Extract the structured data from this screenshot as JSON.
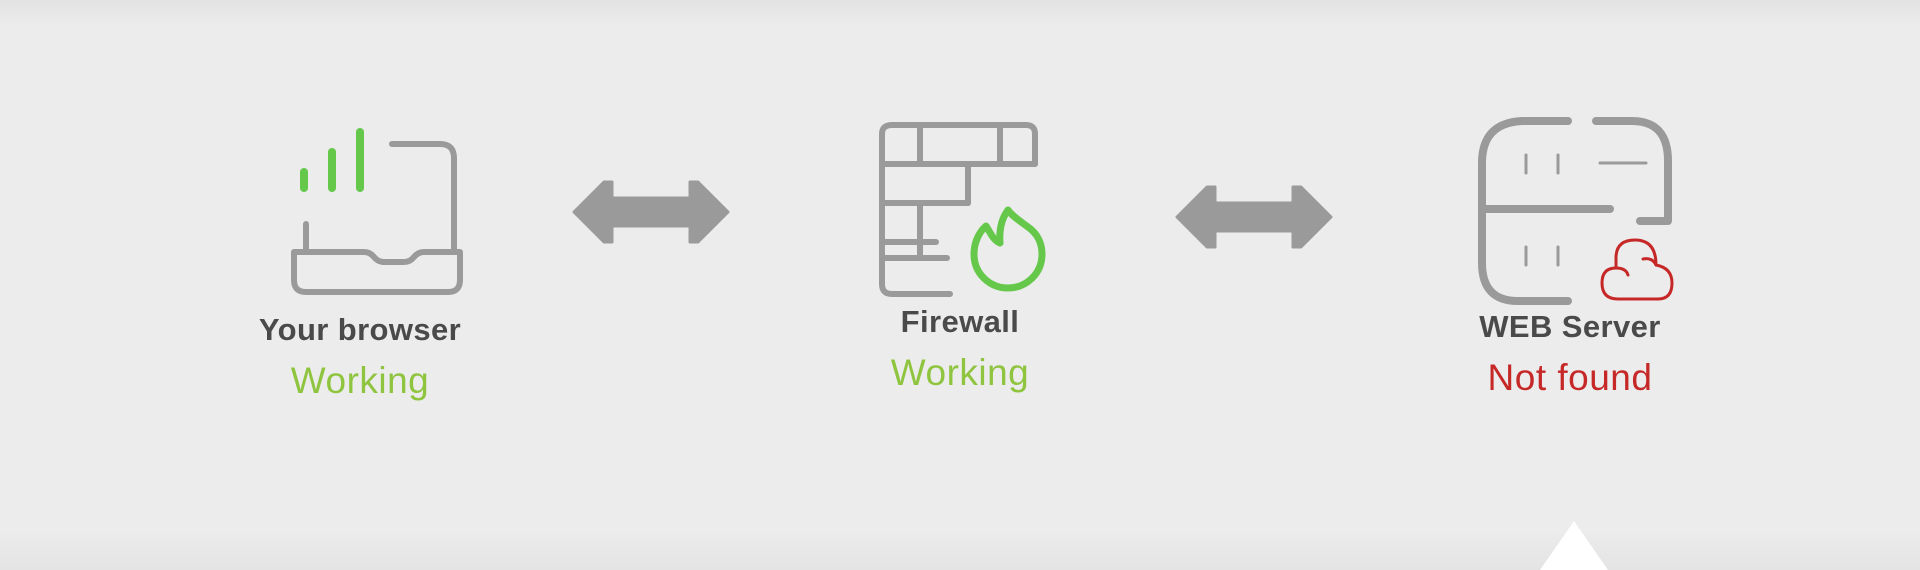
{
  "nodes": [
    {
      "title": "Your browser",
      "status": "Working",
      "status_kind": "ok",
      "icon": "browser-laptop-icon"
    },
    {
      "title": "Firewall",
      "status": "Working",
      "status_kind": "ok",
      "icon": "firewall-icon"
    },
    {
      "title": "WEB Server",
      "status": "Not found",
      "status_kind": "error",
      "icon": "web-server-icon"
    }
  ],
  "colors": {
    "background": "#ececec",
    "icon_gray": "#9a9a9a",
    "ok_green": "#8fc43f",
    "icon_green": "#66c84a",
    "error_red": "#c62828",
    "title_text": "#4a4a4a"
  },
  "connectors": [
    "double-arrow-icon",
    "double-arrow-icon"
  ]
}
